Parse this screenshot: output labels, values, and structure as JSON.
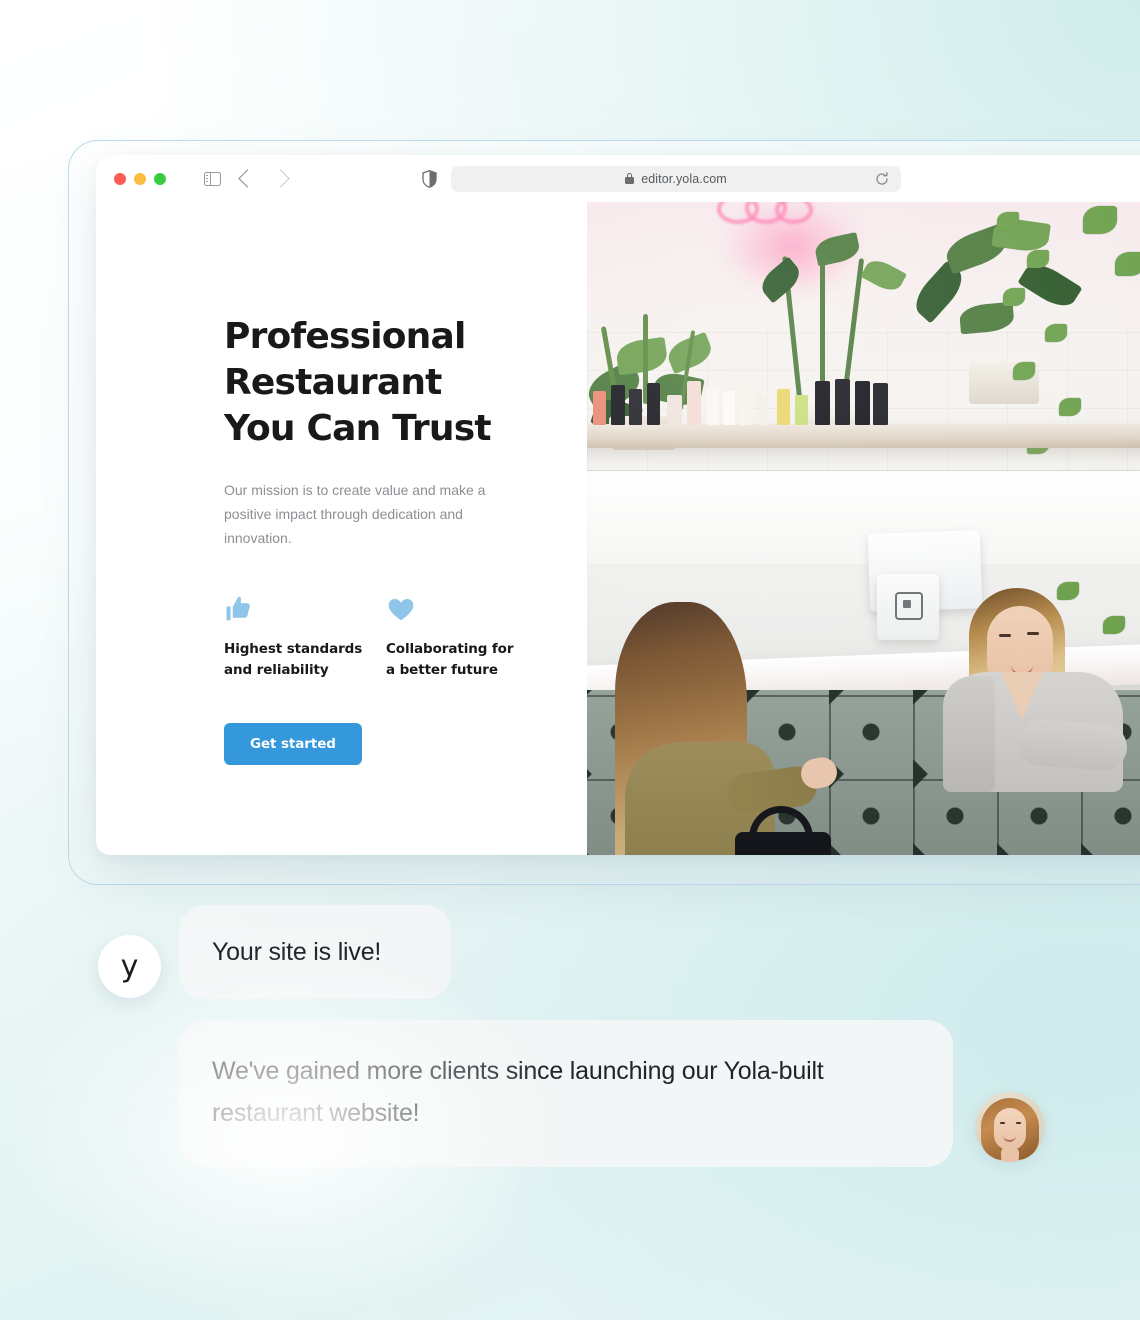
{
  "browser": {
    "traffic_lights": [
      {
        "name": "close",
        "color": "#FC5D55"
      },
      {
        "name": "minimize",
        "color": "#F9BE40"
      },
      {
        "name": "zoom",
        "color": "#3ACC40"
      }
    ],
    "sidebar_toggle_icon": "sidebar-icon",
    "back_icon": "chevron-left-icon",
    "forward_icon": "chevron-right-icon",
    "shield_icon": "shield-icon",
    "lock_icon": "lock-icon",
    "url": "editor.yola.com",
    "reload_icon": "reload-icon"
  },
  "site": {
    "headline": "Professional Restaurant You Can Trust",
    "subtext": "Our mission is to create value and make a positive impact through dedication and innovation.",
    "features": [
      {
        "icon": "thumbs-up-icon",
        "label": "Highest standards and reliability"
      },
      {
        "icon": "heart-icon",
        "label": "Collaborating for a better future"
      }
    ],
    "cta_label": "Get started",
    "photo_alt": "Two women at a salon counter with plants and product shelf",
    "colors": {
      "accent": "#3498db",
      "feature_icon": "#8ec5e9",
      "heading": "#18191b",
      "body_text": "#8c8f93"
    }
  },
  "chat": {
    "brand_avatar_letter": "y",
    "messages": [
      {
        "from": "brand",
        "text": "Your site is live!"
      },
      {
        "from": "user",
        "text": "We've gained more clients since launching our Yola-built restaurant website!"
      }
    ],
    "user_avatar_alt": "Smiling woman portrait"
  },
  "theme": {
    "background_top": "#e4f3f1",
    "background_bottom": "#dff2f1",
    "frame_border": "#bcdcec",
    "bubble_bg": "#f4f6f6"
  }
}
